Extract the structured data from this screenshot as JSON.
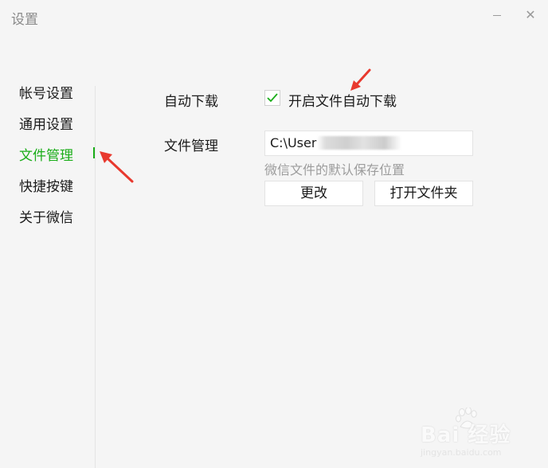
{
  "window": {
    "title": "设置",
    "minimize_icon": "minimize-icon",
    "close_symbol": "✕"
  },
  "sidebar": {
    "items": [
      {
        "label": "帐号设置",
        "active": false
      },
      {
        "label": "通用设置",
        "active": false
      },
      {
        "label": "文件管理",
        "active": true
      },
      {
        "label": "快捷按键",
        "active": false
      },
      {
        "label": "关于微信",
        "active": false
      }
    ]
  },
  "main": {
    "auto_download": {
      "label": "自动下载",
      "checkbox_label": "开启文件自动下载",
      "checked": true
    },
    "file_management": {
      "label": "文件管理",
      "path_value": "C:\\User",
      "hint": "微信文件的默认保存位置",
      "change_button": "更改",
      "open_folder_button": "打开文件夹"
    }
  },
  "colors": {
    "accent": "#1aad19",
    "annotation_arrow": "#e8392e",
    "background": "#f5f5f5"
  },
  "watermark": {
    "text": "Bai 经验",
    "sub": "jingyan.baidu.com"
  }
}
